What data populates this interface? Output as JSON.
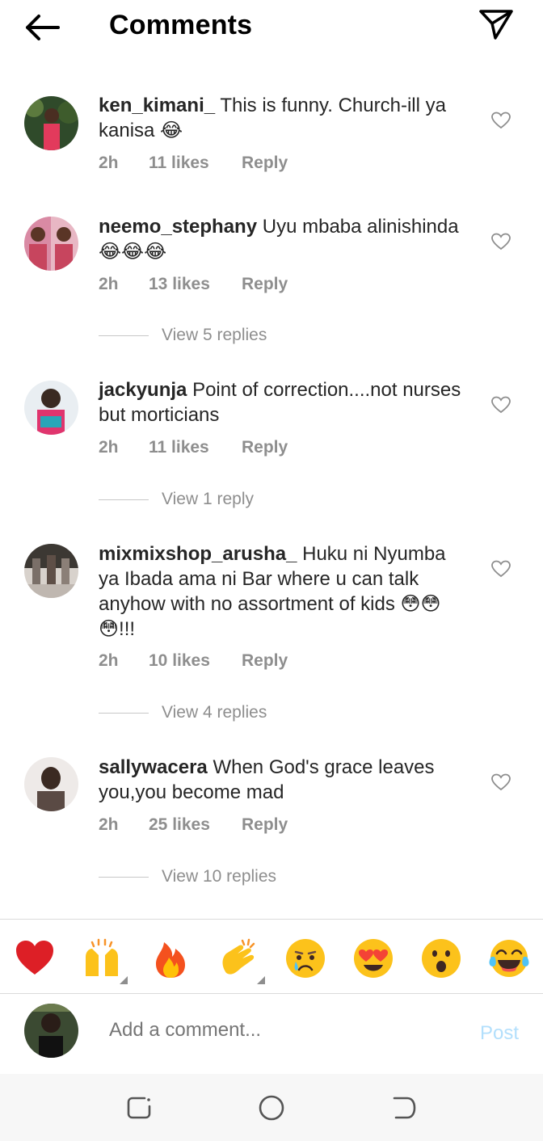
{
  "header": {
    "title": "Comments",
    "back_icon": "back-arrow-icon",
    "share_icon": "send-icon"
  },
  "comments": [
    {
      "username": "ken_kimani_",
      "text": "This is funny. Church-ill ya kanisa 😂",
      "time": "2h",
      "likes": "11 likes",
      "reply": "Reply",
      "view_replies": ""
    },
    {
      "username": "neemo_stephany",
      "text": "Uyu mbaba alinishinda 😂😂😂",
      "time": "2h",
      "likes": "13 likes",
      "reply": "Reply",
      "view_replies": "View 5 replies"
    },
    {
      "username": "jackyunja",
      "text": "Point of correction....not nurses but morticians",
      "time": "2h",
      "likes": "11 likes",
      "reply": "Reply",
      "view_replies": "View 1 reply"
    },
    {
      "username": "mixmixshop_arusha_",
      "text": "Huku ni Nyumba ya Ibada ama ni Bar where u can talk anyhow with no assortment of kids 😳😳😳!!!",
      "time": "2h",
      "likes": "10 likes",
      "reply": "Reply",
      "view_replies": "View 4 replies"
    },
    {
      "username": "sallywacera",
      "text": "When God's grace leaves you,you become mad",
      "time": "2h",
      "likes": "25 likes",
      "reply": "Reply",
      "view_replies": "View 10 replies"
    }
  ],
  "quick_reactions": [
    "❤️",
    "🙌",
    "🔥",
    "👏",
    "😢",
    "😍",
    "😮",
    "😂"
  ],
  "composer": {
    "placeholder": "Add a comment...",
    "post_label": "Post"
  },
  "system_nav": [
    "recents-icon",
    "home-icon",
    "back-icon"
  ],
  "colors": {
    "accent_disabled": "#b2dffc",
    "secondary_text": "#8e8e8e"
  }
}
